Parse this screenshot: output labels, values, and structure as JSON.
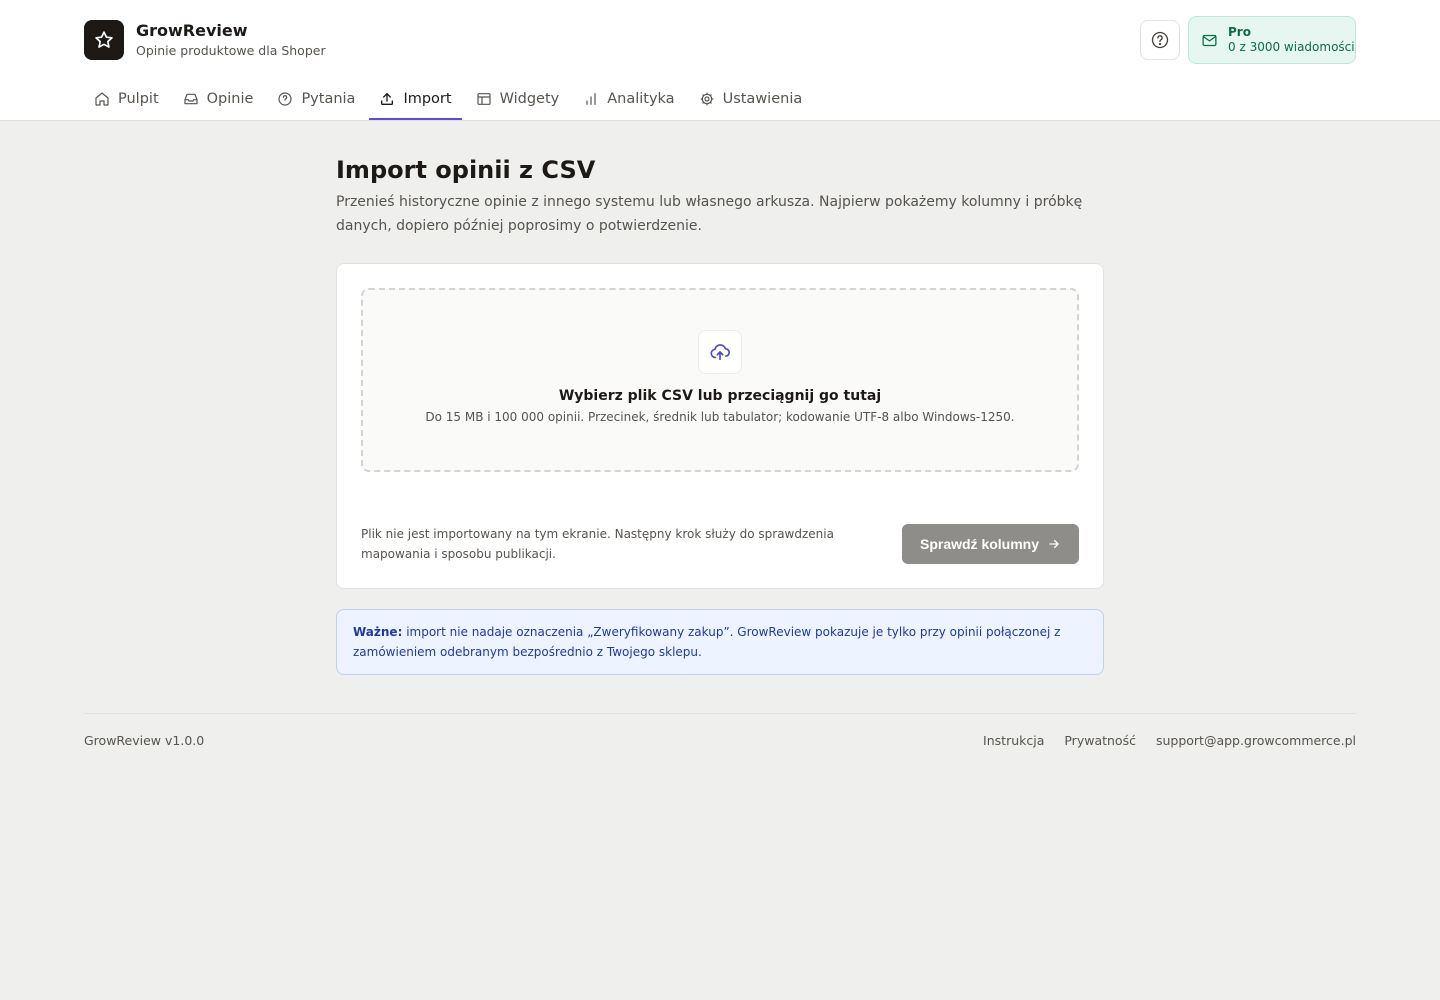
{
  "app": {
    "name": "GrowReview",
    "subtitle": "Opinie produktowe dla Shoper"
  },
  "plan": {
    "name": "Pro",
    "usage": "0 z 3000 wiadomości"
  },
  "nav": {
    "items": [
      {
        "label": "Pulpit",
        "icon": "home-icon"
      },
      {
        "label": "Opinie",
        "icon": "inbox-icon"
      },
      {
        "label": "Pytania",
        "icon": "question-icon"
      },
      {
        "label": "Import",
        "icon": "upload-icon",
        "active": true
      },
      {
        "label": "Widgety",
        "icon": "layout-icon"
      },
      {
        "label": "Analityka",
        "icon": "bar-chart-icon"
      },
      {
        "label": "Ustawienia",
        "icon": "gear-icon"
      }
    ]
  },
  "page": {
    "title": "Import opinii z CSV",
    "description": "Przenieś historyczne opinie z innego systemu lub własnego arkusza. Najpierw pokażemy kolumny i próbkę danych, dopiero później poprosimy o potwierdzenie."
  },
  "dropzone": {
    "title": "Wybierz plik CSV lub przeciągnij go tutaj",
    "hint": "Do 15 MB i 100 000 opinii. Przecinek, średnik lub tabulator; kodowanie UTF-8 albo Windows-1250."
  },
  "card_footer": {
    "note": "Plik nie jest importowany na tym ekranie. Następny krok służy do sprawdzenia mapowania i sposobu publikacji.",
    "button_label": "Sprawdź kolumny"
  },
  "notice": {
    "strong": "Ważne:",
    "text": " import nie nadaje oznaczenia „Zweryfikowany zakup”. GrowReview pokazuje je tylko przy opinii połączonej z zamówieniem odebranym bezpośrednio z Twojego sklepu."
  },
  "footer": {
    "version": "GrowReview v1.0.0",
    "links": [
      "Instrukcja",
      "Prywatność",
      "support@app.growcommerce.pl"
    ]
  },
  "colors": {
    "accent": "#5b4bd6",
    "plan_bg": "#e5f7f0",
    "notice_bg": "#eef4ff",
    "disabled_button": "#8f8d8a"
  }
}
